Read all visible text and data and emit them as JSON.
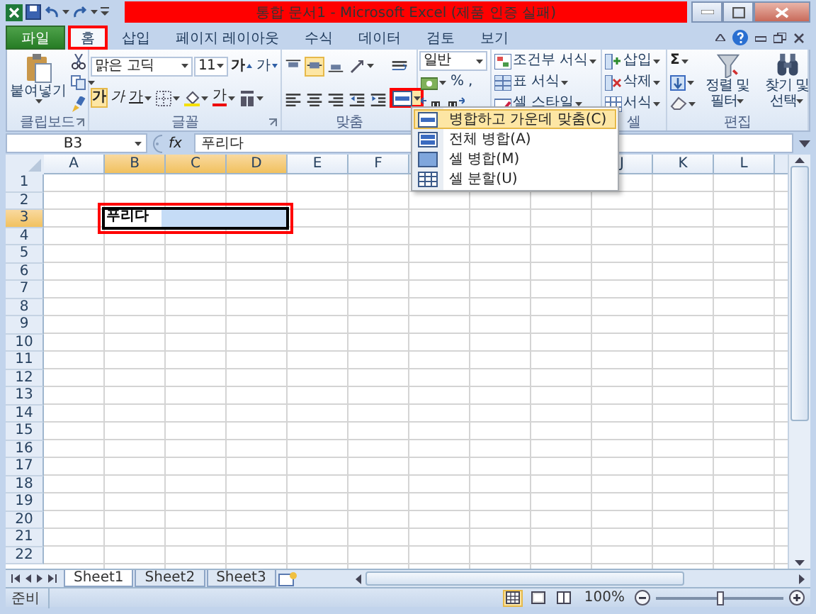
{
  "window": {
    "title": "통합 문서1 - Microsoft Excel (제품 인증 실패)",
    "highlighted": true
  },
  "ribbon_tabs": [
    {
      "label": "파일",
      "kind": "file",
      "selected": false,
      "highlighted": false
    },
    {
      "label": "홈",
      "kind": "tab",
      "selected": true,
      "highlighted": true
    },
    {
      "label": "삽입",
      "kind": "tab",
      "selected": false,
      "highlighted": false
    },
    {
      "label": "페이지 레이아웃",
      "kind": "tab",
      "selected": false,
      "highlighted": false
    },
    {
      "label": "수식",
      "kind": "tab",
      "selected": false,
      "highlighted": false
    },
    {
      "label": "데이터",
      "kind": "tab",
      "selected": false,
      "highlighted": false
    },
    {
      "label": "검토",
      "kind": "tab",
      "selected": false,
      "highlighted": false
    },
    {
      "label": "보기",
      "kind": "tab",
      "selected": false,
      "highlighted": false
    }
  ],
  "clipboard": {
    "paste": "붙여넣기",
    "label": "클립보드"
  },
  "font": {
    "name": "맑은 고딕",
    "size": "11",
    "grow": "가",
    "shrink": "가",
    "bold": {
      "label": "가",
      "on": true
    },
    "italic": {
      "label": "가",
      "on": false
    },
    "underline": {
      "label": "가",
      "on": false
    },
    "color_button": "가",
    "label": "글꼴"
  },
  "alignment": {
    "label": "맞춤",
    "middle_align_on": true,
    "merge_highlighted": true
  },
  "number": {
    "format": "일반",
    "percent": "%",
    "comma": ","
  },
  "styles": {
    "items": [
      "조건부 서식",
      "표 서식",
      "셀 스타일"
    ]
  },
  "cells": {
    "items": [
      "삽입",
      "삭제",
      "서식"
    ],
    "label": "셀"
  },
  "editing": {
    "sum": "Σ",
    "big": [
      "정렬 및 필터",
      "찾기 및 선택"
    ],
    "label": "편집"
  },
  "merge_menu": [
    {
      "label": "병합하고 가운데 맞춤(C)",
      "selected": true
    },
    {
      "label": "전체 병합(A)",
      "selected": false
    },
    {
      "label": "셀 병합(M)",
      "selected": false
    },
    {
      "label": "셀 분할(U)",
      "selected": false
    }
  ],
  "formula_bar": {
    "name_box": "B3",
    "fx": "fx",
    "value": "푸리다"
  },
  "sheet": {
    "columns": [
      {
        "label": "A",
        "selected": false
      },
      {
        "label": "B",
        "selected": true
      },
      {
        "label": "C",
        "selected": true
      },
      {
        "label": "D",
        "selected": true
      },
      {
        "label": "E",
        "selected": false
      },
      {
        "label": "F",
        "selected": false
      }
    ],
    "columns_right": [
      {
        "label": "J",
        "selected": false
      },
      {
        "label": "K",
        "selected": false
      },
      {
        "label": "L",
        "selected": false
      }
    ],
    "rows": [
      {
        "label": "1",
        "selected": false
      },
      {
        "label": "2",
        "selected": false
      },
      {
        "label": "3",
        "selected": true
      },
      {
        "label": "4",
        "selected": false
      },
      {
        "label": "5",
        "selected": false
      },
      {
        "label": "6",
        "selected": false
      },
      {
        "label": "7",
        "selected": false
      },
      {
        "label": "8",
        "selected": false
      },
      {
        "label": "9",
        "selected": false
      },
      {
        "label": "10",
        "selected": false
      },
      {
        "label": "11",
        "selected": false
      },
      {
        "label": "12",
        "selected": false
      },
      {
        "label": "13",
        "selected": false
      },
      {
        "label": "14",
        "selected": false
      },
      {
        "label": "15",
        "selected": false
      },
      {
        "label": "16",
        "selected": false
      },
      {
        "label": "17",
        "selected": false
      },
      {
        "label": "18",
        "selected": false
      },
      {
        "label": "19",
        "selected": false
      },
      {
        "label": "20",
        "selected": false
      },
      {
        "label": "21",
        "selected": false
      },
      {
        "label": "22",
        "selected": false
      }
    ],
    "selection": {
      "value": "푸리다",
      "highlighted": true
    }
  },
  "sheet_tabs": [
    {
      "label": "Sheet1",
      "selected": true
    },
    {
      "label": "Sheet2",
      "selected": false
    },
    {
      "label": "Sheet3",
      "selected": false
    }
  ],
  "status_bar": {
    "state": "준비",
    "zoom": "100%",
    "level": 0.5
  }
}
